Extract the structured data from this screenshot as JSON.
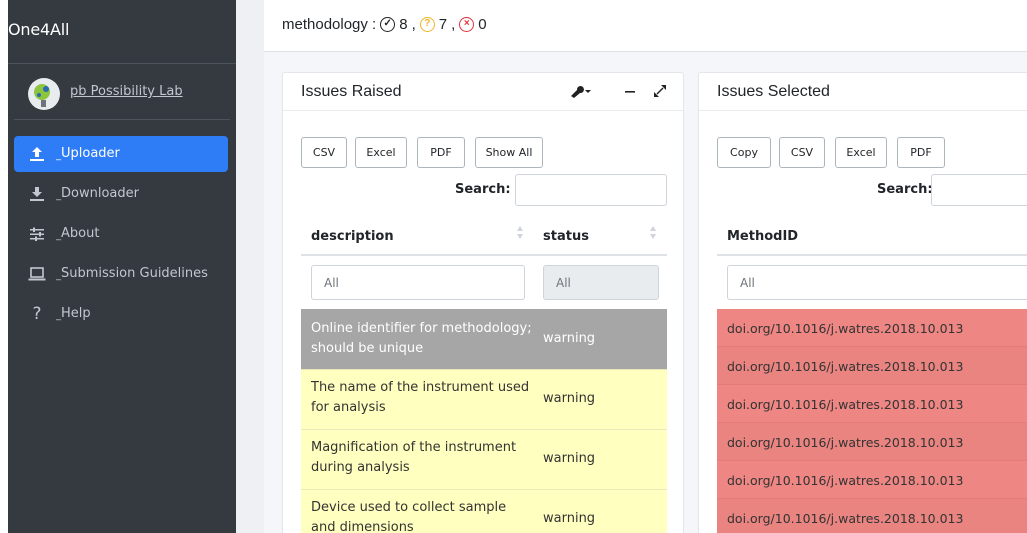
{
  "app": {
    "title": "One4All"
  },
  "user": {
    "name": "pb Possibility Lab"
  },
  "nav": {
    "items": [
      {
        "label": "Uploader",
        "icon": "upload-icon"
      },
      {
        "label": "Downloader",
        "icon": "download-icon"
      },
      {
        "label": "About",
        "icon": "sliders-icon"
      },
      {
        "label": "Submission Guidelines",
        "icon": "laptop-icon"
      },
      {
        "label": "Help",
        "icon": "question-icon"
      }
    ]
  },
  "status_bar": {
    "label": "methodology :",
    "ok_count": "8",
    "warn_count": "7",
    "error_count": "0",
    "sep": ",",
    "ok_icon": "✓",
    "warn_icon": "?",
    "error_icon": "×"
  },
  "issues_raised": {
    "title": "Issues Raised",
    "buttons": [
      "CSV",
      "Excel",
      "PDF",
      "Show All"
    ],
    "search_label": "Search:",
    "columns": [
      "description",
      "status"
    ],
    "filter_placeholders": [
      "All",
      "All"
    ],
    "rows": [
      {
        "description": "Online identifier for methodology; should be unique",
        "status": "warning"
      },
      {
        "description": "The name of the instrument used for analysis",
        "status": "warning"
      },
      {
        "description": "Magnification of the instrument during analysis",
        "status": "warning"
      },
      {
        "description": "Device used to collect sample and dimensions",
        "status": "warning"
      }
    ]
  },
  "issues_selected": {
    "title": "Issues Selected",
    "buttons": [
      "Copy",
      "CSV",
      "Excel",
      "PDF"
    ],
    "search_label": "Search:",
    "columns": [
      "MethodID"
    ],
    "filter_placeholders": [
      "All"
    ],
    "rows": [
      "doi.org/10.1016/j.watres.2018.10.013",
      "doi.org/10.1016/j.watres.2018.10.013",
      "doi.org/10.1016/j.watres.2018.10.013",
      "doi.org/10.1016/j.watres.2018.10.013",
      "doi.org/10.1016/j.watres.2018.10.013",
      "doi.org/10.1016/j.watres.2018.10.013"
    ]
  },
  "colors": {
    "sidebar": "#343a40",
    "active": "#2f7df6",
    "row_grey": "#a6a6a6",
    "row_yellow": "#ffffc0",
    "row_red": "#ee8683"
  }
}
